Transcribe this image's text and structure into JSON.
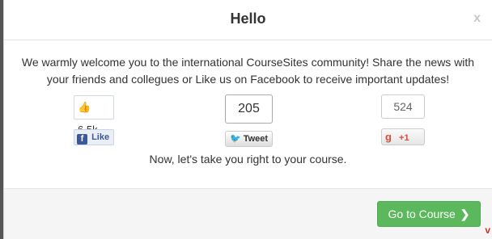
{
  "modal": {
    "title": "Hello",
    "close_label": "x",
    "welcome_line1": "We warmly welcome you to the international CourseSites community! Share the news with",
    "welcome_line2": "your friends and collegues or Like us on Facebook to receive important updates!",
    "take_text": "Now, let's take you right to your course."
  },
  "social": {
    "facebook": {
      "count": "6.5k",
      "button_label": "Like"
    },
    "twitter": {
      "count": "205",
      "button_label": "Tweet"
    },
    "google_plus": {
      "count": "524",
      "button_label": "+1"
    }
  },
  "footer": {
    "go_label": "Go to Course"
  }
}
